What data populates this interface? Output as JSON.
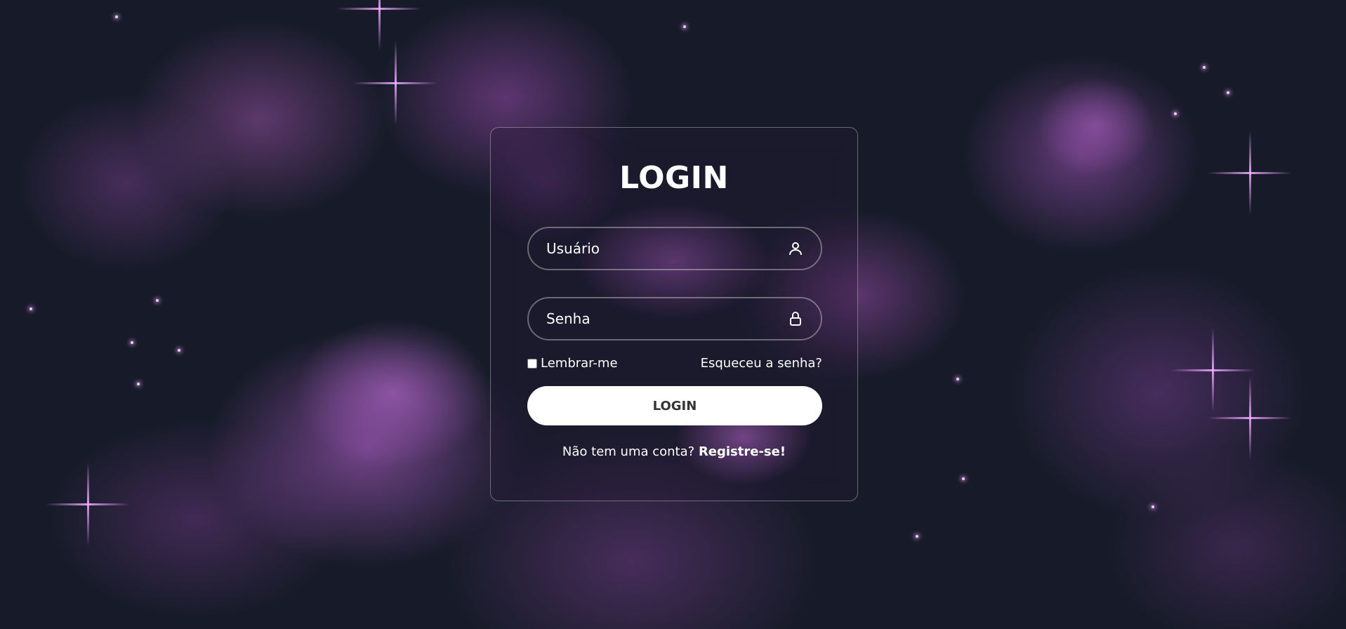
{
  "login": {
    "title": "LOGIN",
    "username": {
      "placeholder": "Usuário",
      "icon": "user-icon"
    },
    "password": {
      "placeholder": "Senha",
      "icon": "lock-icon"
    },
    "remember_label": "Lembrar-me",
    "remember_checked": false,
    "forgot_label": "Esqueceu a senha?",
    "button_label": "LOGIN",
    "register_prompt": "Não tem uma conta?",
    "register_link": "Registre-se!"
  },
  "colors": {
    "background": "#171b29",
    "nebula": "#9b4fb0",
    "button_bg": "#ffffff",
    "button_text": "#333333",
    "text": "#ffffff"
  }
}
